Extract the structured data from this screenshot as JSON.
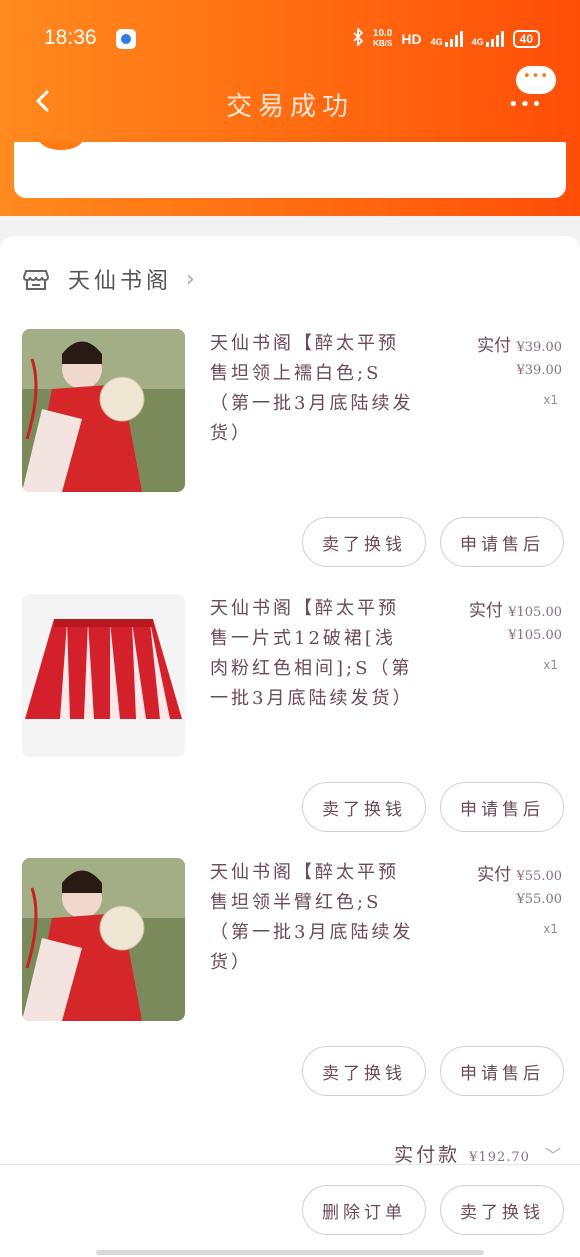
{
  "status_bar": {
    "time": "18:36",
    "speed_top": "10.0",
    "speed_bottom": "KB/S",
    "hd": "HD",
    "net1": "4G",
    "net2": "4G",
    "battery": "40"
  },
  "nav": {
    "title": "交易成功"
  },
  "shop": {
    "name": "天仙书阁"
  },
  "items": [
    {
      "title": "天仙书阁【醉太平预售坦领上襦白色;S（第一批3月底陆续发货）",
      "paid_label": "实付",
      "paid_amount": "¥39.00",
      "price": "¥39.00",
      "qty": "x1",
      "btn_sell": "卖了换钱",
      "btn_after": "申请售后"
    },
    {
      "title": "天仙书阁【醉太平预售一片式12破裙[浅肉粉红色相间];S（第一批3月底陆续发货）",
      "paid_label": "实付",
      "paid_amount": "¥105.00",
      "price": "¥105.00",
      "qty": "x1",
      "btn_sell": "卖了换钱",
      "btn_after": "申请售后"
    },
    {
      "title": "天仙书阁【醉太平预售坦领半臂红色;S（第一批3月底陆续发货）",
      "paid_label": "实付",
      "paid_amount": "¥55.00",
      "price": "¥55.00",
      "qty": "x1",
      "btn_sell": "卖了换钱",
      "btn_after": "申请售后"
    }
  ],
  "total": {
    "label": "实付款",
    "amount": "¥192.70"
  },
  "bottom": {
    "delete_btn": "删除订单",
    "sell_btn": "卖了换钱"
  },
  "colors": {
    "header_start": "#ff8a1e",
    "header_end": "#ff4e08",
    "text": "#6b4a5a"
  }
}
